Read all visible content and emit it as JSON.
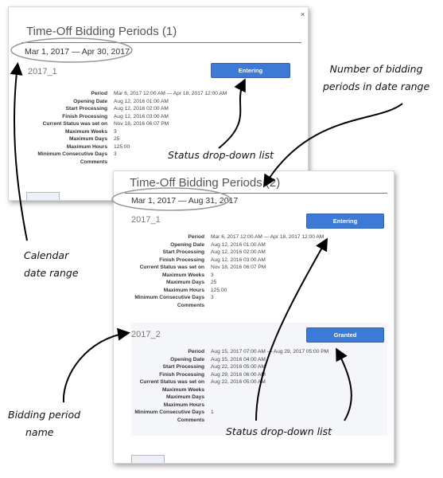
{
  "panel1": {
    "title": "Time-Off Bidding Periods (1)",
    "date_range": "Mar 1, 2017 — Apr 30, 2017",
    "close_glyph": "×",
    "period": {
      "name": "2017_1",
      "status": "Entering",
      "rows": [
        {
          "label": "Period",
          "value": "Mar 6, 2017 12:00 AM — Apr 18, 2017 12:00 AM"
        },
        {
          "label": "Opening Date",
          "value": "Aug 12, 2016 01:00 AM"
        },
        {
          "label": "Start Processing",
          "value": "Aug 12, 2016 02:00 AM"
        },
        {
          "label": "Finish Processing",
          "value": "Aug 12, 2016 03:00 AM"
        },
        {
          "label": "Current Status was set on",
          "value": "Nov 18, 2016 06:07 PM"
        },
        {
          "label": "Maximum Weeks",
          "value": "3"
        },
        {
          "label": "Maximum Days",
          "value": "25"
        },
        {
          "label": "Maximum Hours",
          "value": "125:00"
        },
        {
          "label": "Minimum Consecutive Days",
          "value": "3"
        },
        {
          "label": "Comments",
          "value": ""
        }
      ]
    }
  },
  "panel2": {
    "title": "Time-Off Bidding Periods (2)",
    "date_range": "Mar 1, 2017 — Aug 31, 2017",
    "periods": [
      {
        "name": "2017_1",
        "status": "Entering",
        "rows": [
          {
            "label": "Period",
            "value": "Mar 6, 2017 12:00 AM — Apr 18, 2017 12:00 AM"
          },
          {
            "label": "Opening Date",
            "value": "Aug 12, 2016 01:00 AM"
          },
          {
            "label": "Start Processing",
            "value": "Aug 12, 2016 02:00 AM"
          },
          {
            "label": "Finish Processing",
            "value": "Aug 12, 2016 03:00 AM"
          },
          {
            "label": "Current Status was set on",
            "value": "Nov 18, 2016 06:07 PM"
          },
          {
            "label": "Maximum Weeks",
            "value": "3"
          },
          {
            "label": "Maximum Days",
            "value": "25"
          },
          {
            "label": "Maximum Hours",
            "value": "125:00"
          },
          {
            "label": "Minimum Consecutive Days",
            "value": "3"
          },
          {
            "label": "Comments",
            "value": ""
          }
        ]
      },
      {
        "name": "2017_2",
        "status": "Granted",
        "rows": [
          {
            "label": "Period",
            "value": "Aug 15, 2017 07:00 AM — Aug 29, 2017 05:00 PM"
          },
          {
            "label": "Opening Date",
            "value": "Aug 15, 2016 04:00 AM"
          },
          {
            "label": "Start Processing",
            "value": "Aug 22, 2016 05:00 AM"
          },
          {
            "label": "Finish Processing",
            "value": "Aug 29, 2016 06:00 AM"
          },
          {
            "label": "Current Status was set on",
            "value": "Aug 22, 2016 05:00 AM"
          },
          {
            "label": "Maximum Weeks",
            "value": ""
          },
          {
            "label": "Maximum Days",
            "value": ""
          },
          {
            "label": "Maximum Hours",
            "value": ""
          },
          {
            "label": "Minimum Consecutive Days",
            "value": "1"
          },
          {
            "label": "Comments",
            "value": ""
          }
        ]
      }
    ]
  },
  "callouts": {
    "number_of_periods": [
      "Number of bidding",
      "periods in date range"
    ],
    "status_list_1": "Status drop-down list",
    "calendar_range": [
      "Calendar",
      "date range"
    ],
    "period_name": [
      "Bidding period",
      "name"
    ],
    "status_list_2": "Status drop-down list"
  }
}
